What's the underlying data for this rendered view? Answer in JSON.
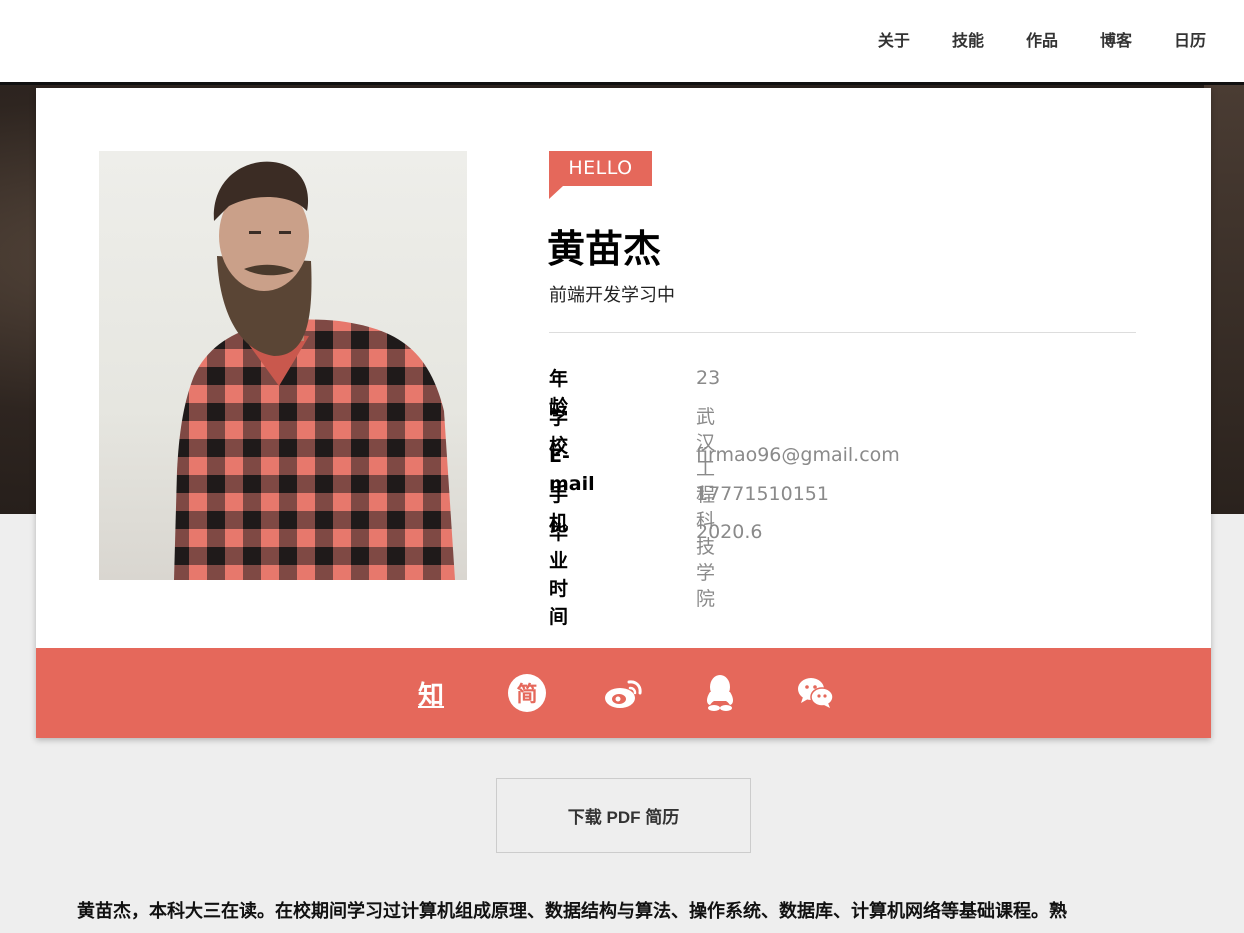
{
  "nav": {
    "items": [
      "关于",
      "技能",
      "作品",
      "博客",
      "日历"
    ]
  },
  "profile": {
    "badge": "HELLO",
    "name": "黄苗杰",
    "subtitle": "前端开发学习中",
    "info": [
      {
        "label": "年龄",
        "value": "23"
      },
      {
        "label": "学校",
        "value": "武汉工程科技学院"
      },
      {
        "label": "E-mail",
        "value": "firmao96@gmail.com"
      },
      {
        "label": "手机",
        "value": "17771510151"
      },
      {
        "label": "毕业时间",
        "value": "2020.6"
      }
    ]
  },
  "social": {
    "icons": [
      "zhihu-icon",
      "jianshu-icon",
      "weibo-icon",
      "qq-icon",
      "wechat-icon"
    ],
    "zhihu_glyph": "知",
    "jianshu_glyph": "简"
  },
  "download": {
    "label": "下载 PDF 简历"
  },
  "bio": {
    "text": "黄苗杰，本科大三在读。在校期间学习过计算机组成原理、数据结构与算法、操作系统、数据库、计算机网络等基础课程。熟"
  },
  "colors": {
    "accent": "#e5685b",
    "background": "#eeeeee",
    "value_text": "#8a8a8a"
  }
}
